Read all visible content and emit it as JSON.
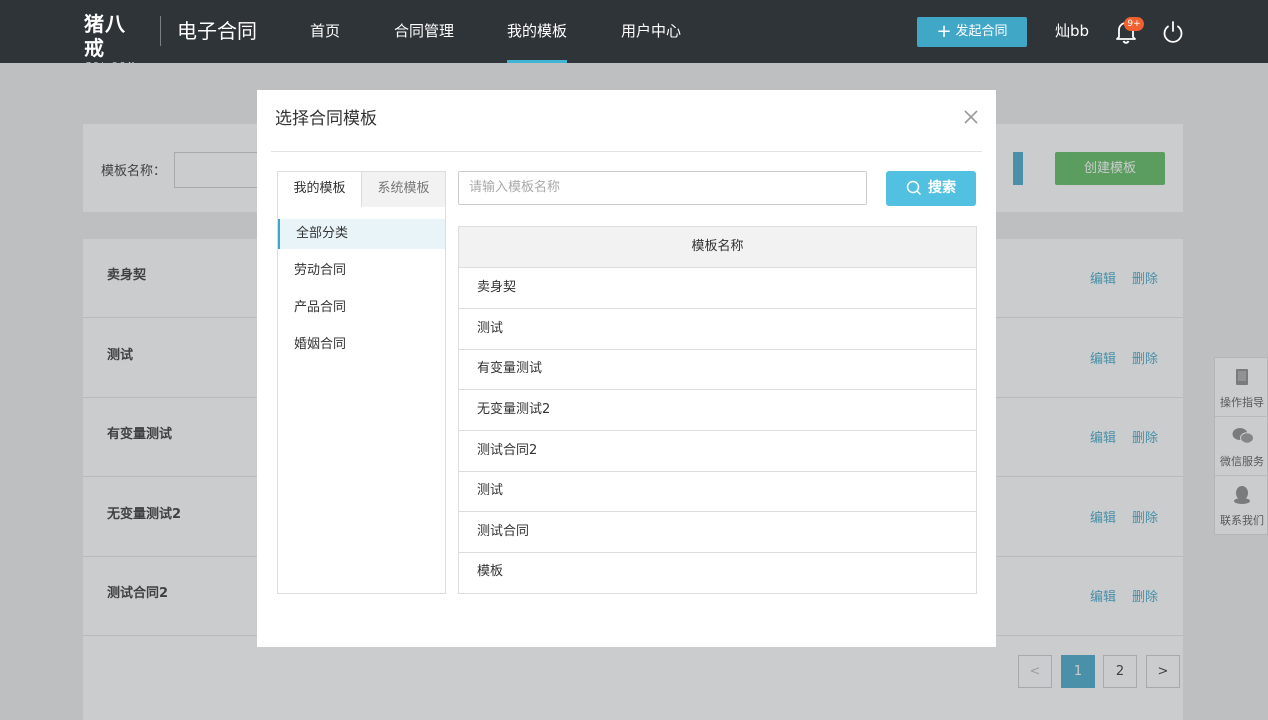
{
  "header": {
    "logo_text": "猪八戒",
    "logo_sub": "ZBJ.COM",
    "product_name": "电子合同",
    "nav": [
      {
        "label": "首页"
      },
      {
        "label": "合同管理"
      },
      {
        "label": "我的模板",
        "active": true
      },
      {
        "label": "用户中心"
      }
    ],
    "start_button": "发起合同",
    "username": "灿bb",
    "notification_badge": "9+"
  },
  "background_page": {
    "filter_label": "模板名称：",
    "create_button": "创建模板",
    "rows": [
      {
        "name": "卖身契",
        "edit": "编辑",
        "delete": "删除"
      },
      {
        "name": "测试",
        "edit": "编辑",
        "delete": "删除"
      },
      {
        "name": "有变量测试",
        "edit": "编辑",
        "delete": "删除"
      },
      {
        "name": "无变量测试2",
        "edit": "编辑",
        "delete": "删除"
      },
      {
        "name": "测试合同2",
        "edit": "编辑",
        "delete": "删除"
      }
    ],
    "pagination": {
      "prev": "<",
      "pages": [
        "1",
        "2"
      ],
      "current": "1",
      "next": ">"
    }
  },
  "float_toolbar": [
    {
      "label": "操作指导",
      "icon": "book-icon"
    },
    {
      "label": "微信服务",
      "icon": "wechat-icon"
    },
    {
      "label": "联系我们",
      "icon": "qq-icon"
    }
  ],
  "modal": {
    "title": "选择合同模板",
    "tabs": [
      {
        "label": "我的模板",
        "active": true
      },
      {
        "label": "系统模板"
      }
    ],
    "categories": [
      {
        "label": "全部分类",
        "active": true
      },
      {
        "label": "劳动合同"
      },
      {
        "label": "产品合同"
      },
      {
        "label": "婚姻合同"
      }
    ],
    "search_placeholder": "请输入模板名称",
    "search_button": "搜索",
    "table_header": "模板名称",
    "templates": [
      "卖身契",
      "测试",
      "有变量测试",
      "无变量测试2",
      "测试合同2",
      "测试",
      "测试合同",
      "模板"
    ]
  },
  "colors": {
    "header_bg": "#2f3439",
    "accent": "#41a7c7",
    "search_button": "#52c0e0",
    "create_button": "#5cb85c",
    "badge": "#f0612f"
  }
}
